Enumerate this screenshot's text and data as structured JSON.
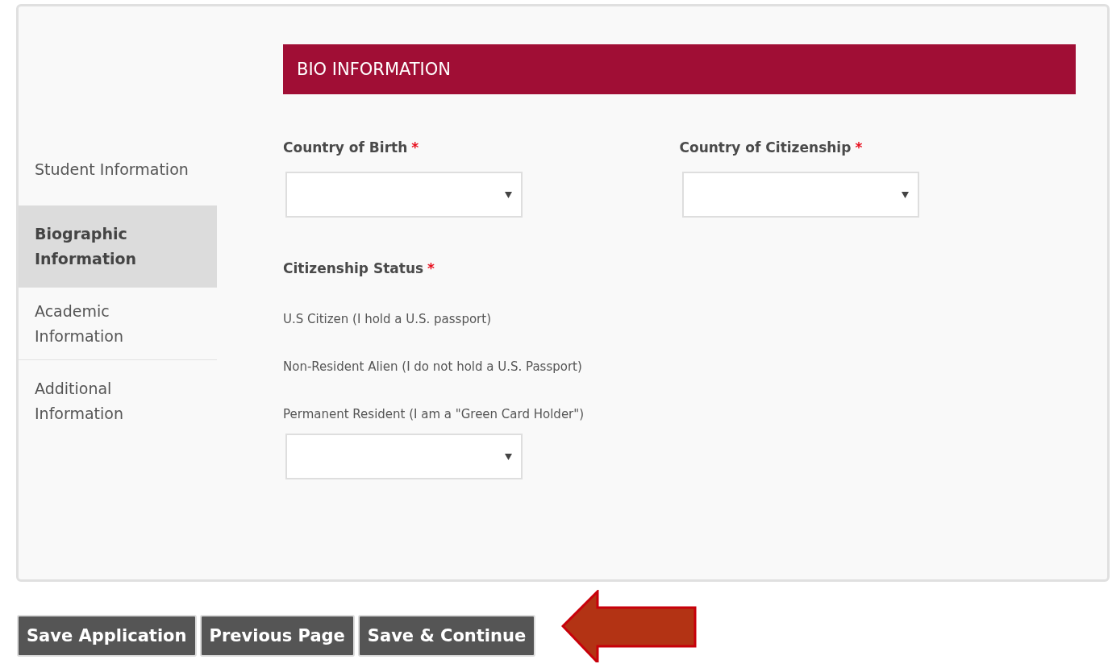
{
  "sidebar": {
    "items": [
      {
        "label": "Student Information",
        "selected": false
      },
      {
        "label": "Biographic Information",
        "selected": true
      },
      {
        "label": "Academic Information",
        "selected": false
      },
      {
        "label": "Additional Information",
        "selected": false
      }
    ]
  },
  "section": {
    "title": "BIO INFORMATION"
  },
  "fields": [
    {
      "kind": "select",
      "label": "Country of Birth",
      "required_mark": "*"
    },
    {
      "kind": "select",
      "label": "Country of Citizenship",
      "required_mark": "*"
    }
  ],
  "citizenship": {
    "label": "Citizenship Status",
    "required_mark": "*",
    "options": [
      "U.S Citizen (I hold a U.S. passport)",
      "Non-Resident Alien (I do not hold a U.S. Passport)",
      "Permanent Resident (I am a \"Green Card Holder\")"
    ]
  },
  "buttons": [
    "Save Application",
    "Previous Page",
    "Save & Continue"
  ]
}
